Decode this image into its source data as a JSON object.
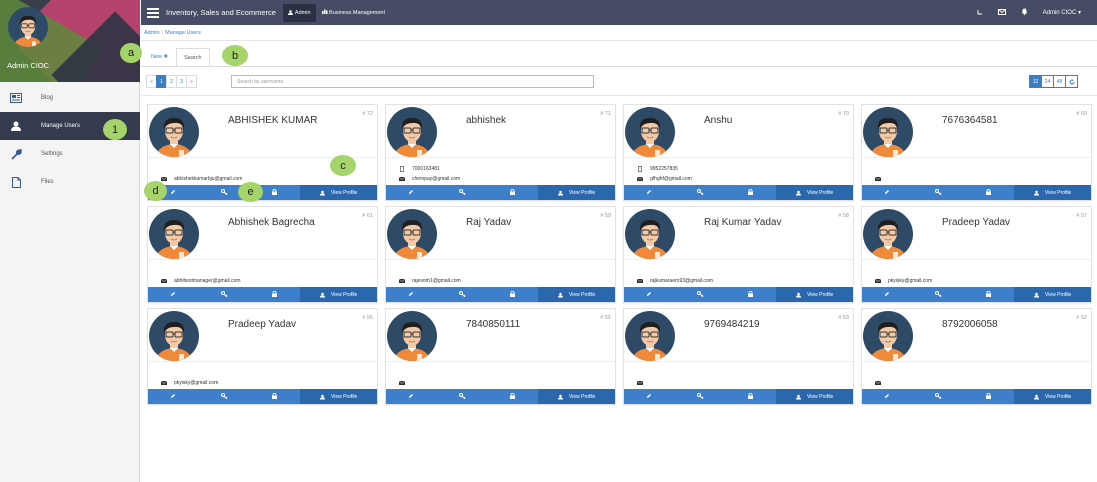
{
  "app": {
    "title": "Inventory, Sales and Ecommerce"
  },
  "topbar": {
    "admin_label": "Admin",
    "bm_label": "Business Management",
    "user_label": "Admin CIOC"
  },
  "sidebar": {
    "username": "Admin CIOC",
    "items": [
      {
        "label": "Blog",
        "icon": "newspaper-icon"
      },
      {
        "label": "Manage Users",
        "icon": "user-icon",
        "active": true
      },
      {
        "label": "Settings",
        "icon": "wrench-icon"
      },
      {
        "label": "Files",
        "icon": "file-icon"
      }
    ]
  },
  "breadcrumb": {
    "items": [
      "Admin",
      "Manage Users"
    ],
    "separator": "/"
  },
  "tabs": {
    "new_label": "New",
    "search_label": "Search"
  },
  "pagination": {
    "prev": "«",
    "pages": [
      "1",
      "2",
      "3"
    ],
    "next": "»",
    "active_page": "1"
  },
  "search": {
    "placeholder": "Search by username"
  },
  "page_size": {
    "options": [
      "12",
      "24",
      "48"
    ],
    "selected": "12",
    "refresh_icon": "refresh-icon"
  },
  "bubbles": {
    "a": "a",
    "b": "b",
    "c": "c",
    "d": "d",
    "e": "e",
    "one": "1"
  },
  "colors": {
    "topbar": "#454c64",
    "sidebar_active": "#343b4f",
    "action_blue": "#3d7fca",
    "view_blue": "#2b67ad",
    "bubble": "#a5d46a"
  },
  "action_labels": {
    "view": "View Profile"
  },
  "users": [
    {
      "name": "ABHISHEK KUMAR",
      "num": "# 72",
      "phone": "",
      "email": "abhishekkumarbju@gmail.com"
    },
    {
      "name": "abhishek",
      "num": "# 71",
      "phone": "7000163481",
      "email": "chempay@gmail.com"
    },
    {
      "name": "Anshu",
      "num": "# 70",
      "phone": "9952257835",
      "email": "gfhghf@gmail.com"
    },
    {
      "name": "7676364581",
      "num": "# 69",
      "phone": "",
      "email": ""
    },
    {
      "name": "Abhishek Bagrecha",
      "num": "# 61",
      "phone": "",
      "email": "abhibestmanager@gmail.com"
    },
    {
      "name": "Raj Yadav",
      "num": "# 59",
      "phone": "",
      "email": "rajesorh1@gmail.com"
    },
    {
      "name": "Raj Kumar Yadav",
      "num": "# 58",
      "phone": "",
      "email": "rajkumaraero93@gmail.com"
    },
    {
      "name": "Pradeep Yadav",
      "num": "# 57",
      "phone": "",
      "email": "pkyisky@gmail.com"
    },
    {
      "name": "Pradeep Yadav",
      "num": "# 56",
      "phone": "",
      "email": "pkyisky@gmail.com"
    },
    {
      "name": "7840850111",
      "num": "# 55",
      "phone": "",
      "email": ""
    },
    {
      "name": "9769484219",
      "num": "# 53",
      "phone": "",
      "email": ""
    },
    {
      "name": "8792006058",
      "num": "# 52",
      "phone": "",
      "email": ""
    }
  ]
}
